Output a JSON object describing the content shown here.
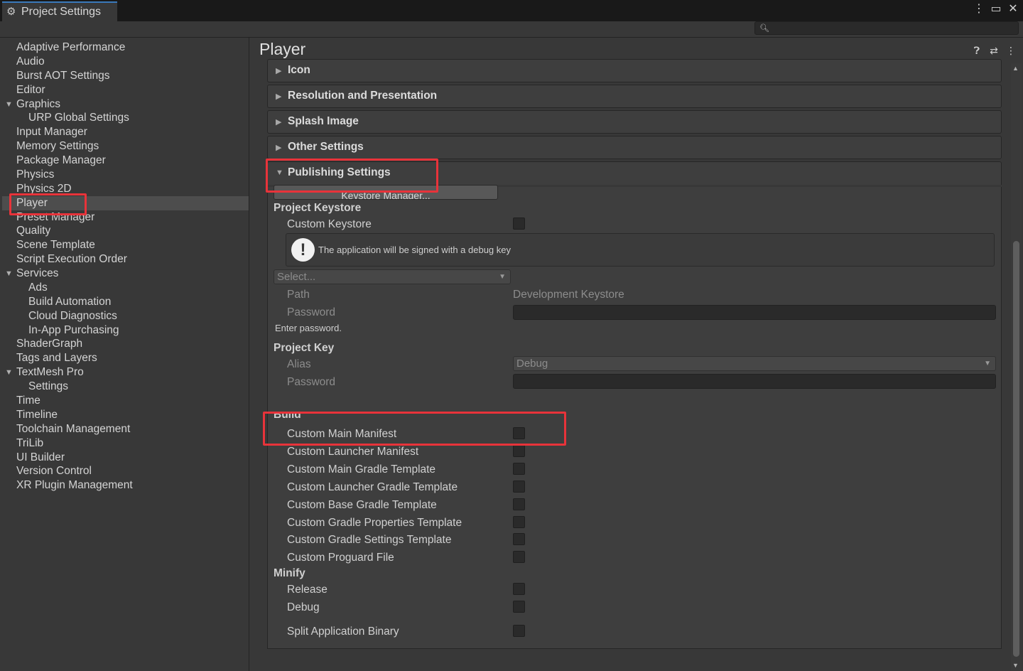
{
  "window": {
    "tab_label": "Project Settings",
    "tab_icon": "gear-icon",
    "controls": [
      "more-options-icon",
      "maximize-icon",
      "close-icon"
    ]
  },
  "search": {
    "placeholder": "",
    "icon": "search-icon"
  },
  "sidebar": {
    "items": [
      {
        "label": "Adaptive Performance",
        "indent": 0
      },
      {
        "label": "Audio",
        "indent": 0
      },
      {
        "label": "Burst AOT Settings",
        "indent": 0
      },
      {
        "label": "Editor",
        "indent": 0
      },
      {
        "label": "Graphics",
        "indent": 0,
        "expanded": true
      },
      {
        "label": "URP Global Settings",
        "indent": 1
      },
      {
        "label": "Input Manager",
        "indent": 0
      },
      {
        "label": "Memory Settings",
        "indent": 0
      },
      {
        "label": "Package Manager",
        "indent": 0
      },
      {
        "label": "Physics",
        "indent": 0
      },
      {
        "label": "Physics 2D",
        "indent": 0
      },
      {
        "label": "Player",
        "indent": 0,
        "selected": true
      },
      {
        "label": "Preset Manager",
        "indent": 0
      },
      {
        "label": "Quality",
        "indent": 0
      },
      {
        "label": "Scene Template",
        "indent": 0
      },
      {
        "label": "Script Execution Order",
        "indent": 0
      },
      {
        "label": "Services",
        "indent": 0,
        "expanded": true
      },
      {
        "label": "Ads",
        "indent": 1
      },
      {
        "label": "Build Automation",
        "indent": 1
      },
      {
        "label": "Cloud Diagnostics",
        "indent": 1
      },
      {
        "label": "In-App Purchasing",
        "indent": 1
      },
      {
        "label": "ShaderGraph",
        "indent": 0
      },
      {
        "label": "Tags and Layers",
        "indent": 0
      },
      {
        "label": "TextMesh Pro",
        "indent": 0,
        "expanded": true
      },
      {
        "label": "Settings",
        "indent": 1
      },
      {
        "label": "Time",
        "indent": 0
      },
      {
        "label": "Timeline",
        "indent": 0
      },
      {
        "label": "Toolchain Management",
        "indent": 0
      },
      {
        "label": "TriLib",
        "indent": 0
      },
      {
        "label": "UI Builder",
        "indent": 0
      },
      {
        "label": "Version Control",
        "indent": 0
      },
      {
        "label": "XR Plugin Management",
        "indent": 0
      }
    ]
  },
  "main": {
    "title": "Player",
    "header_icons": [
      "help-icon",
      "presets-icon",
      "more-options-icon"
    ],
    "sections": {
      "icon": "Icon",
      "resolution": "Resolution and Presentation",
      "splash": "Splash Image",
      "other": "Other Settings",
      "publishing": "Publishing Settings"
    },
    "publishing": {
      "keystore_manager_button": "Keystore Manager...",
      "project_keystore_heading": "Project Keystore",
      "custom_keystore_label": "Custom Keystore",
      "help_message": "The application will be signed with a debug key",
      "select_dropdown": "Select...",
      "path_label": "Path",
      "path_value": "Development Keystore",
      "password_label": "Password",
      "enter_password_hint": "Enter password.",
      "project_key_heading": "Project Key",
      "alias_label": "Alias",
      "alias_value": "Debug",
      "key_password_label": "Password",
      "build_heading": "Build",
      "build_options": [
        "Custom Main Manifest",
        "Custom Launcher Manifest",
        "Custom Main Gradle Template",
        "Custom Launcher Gradle Template",
        "Custom Base Gradle Template",
        "Custom Gradle Properties Template",
        "Custom Gradle Settings Template",
        "Custom Proguard File"
      ],
      "minify_heading": "Minify",
      "minify_options": [
        "Release",
        "Debug"
      ],
      "split_binary_label": "Split Application Binary"
    }
  },
  "colors": {
    "background": "#383838",
    "titlebar": "#191919",
    "selected_item": "#4d4d4d",
    "highlight": "#e8333a"
  }
}
